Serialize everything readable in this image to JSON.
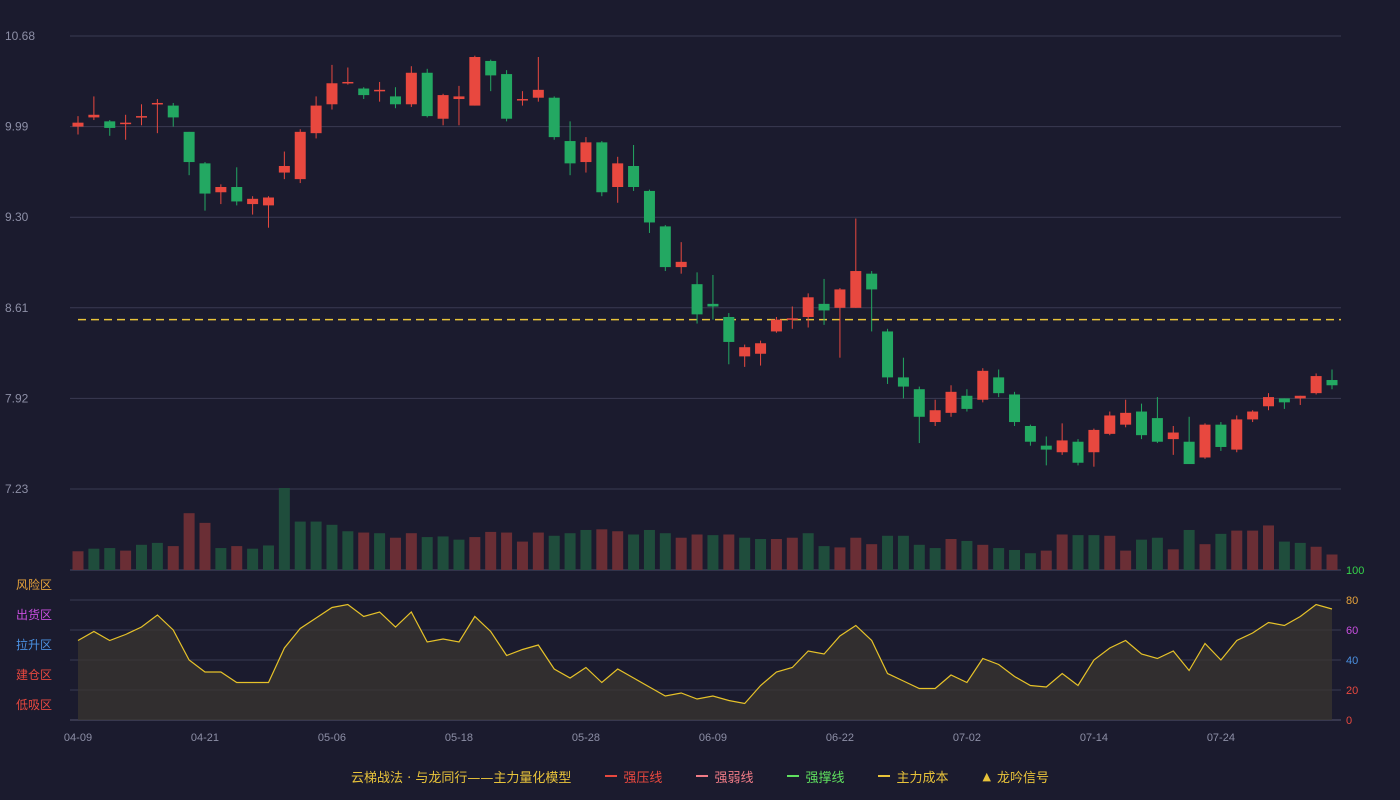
{
  "colors": {
    "background": "#1b1b2e",
    "up": "#e8483f",
    "down": "#23a862",
    "up_volume": "#6a2e35",
    "down_volume": "#1f4d3c",
    "main_cost_line": "#e8c33a",
    "indicator_line": "#e6c229",
    "grid": "#3a3b52",
    "tick_text": "#8d8fa6"
  },
  "chart_data": [
    {
      "type": "candlestick",
      "yticks": [
        "10.68",
        "9.99",
        "9.30",
        "8.61",
        "7.92",
        "7.23"
      ],
      "ylim": [
        7.23,
        10.68
      ],
      "xticks": [
        "04-09",
        "04-21",
        "05-06",
        "05-18",
        "05-28",
        "06-09",
        "06-22",
        "07-02",
        "07-14",
        "07-24"
      ],
      "xtick_index": [
        0,
        8,
        16,
        24,
        32,
        40,
        48,
        56,
        64,
        72
      ],
      "main_cost_level": 8.52,
      "candles": [
        [
          9.99,
          10.02,
          10.07,
          9.93
        ],
        [
          10.06,
          10.08,
          10.22,
          10.04
        ],
        [
          10.03,
          9.98,
          10.04,
          9.92
        ],
        [
          10.02,
          10.02,
          10.08,
          9.89
        ],
        [
          10.06,
          10.07,
          10.16,
          10.0
        ],
        [
          10.16,
          10.17,
          10.2,
          9.94
        ],
        [
          10.15,
          10.06,
          10.17,
          9.99
        ],
        [
          9.95,
          9.72,
          9.95,
          9.62
        ],
        [
          9.71,
          9.48,
          9.72,
          9.35
        ],
        [
          9.49,
          9.53,
          9.55,
          9.4
        ],
        [
          9.53,
          9.42,
          9.68,
          9.39
        ],
        [
          9.4,
          9.44,
          9.46,
          9.32
        ],
        [
          9.39,
          9.45,
          9.46,
          9.22
        ],
        [
          9.64,
          9.69,
          9.8,
          9.59
        ],
        [
          9.59,
          9.95,
          9.97,
          9.56
        ],
        [
          9.94,
          10.15,
          10.22,
          9.9
        ],
        [
          10.16,
          10.32,
          10.46,
          10.12
        ],
        [
          10.32,
          10.33,
          10.44,
          10.31
        ],
        [
          10.28,
          10.23,
          10.29,
          10.2
        ],
        [
          10.26,
          10.27,
          10.33,
          10.18
        ],
        [
          10.22,
          10.16,
          10.29,
          10.13
        ],
        [
          10.16,
          10.4,
          10.45,
          10.14
        ],
        [
          10.4,
          10.07,
          10.43,
          10.06
        ],
        [
          10.05,
          10.23,
          10.24,
          10.0
        ],
        [
          10.2,
          10.22,
          10.3,
          10.0
        ],
        [
          10.15,
          10.52,
          10.53,
          10.15
        ],
        [
          10.49,
          10.38,
          10.5,
          10.26
        ],
        [
          10.39,
          10.05,
          10.42,
          10.03
        ],
        [
          10.19,
          10.2,
          10.26,
          10.15
        ],
        [
          10.21,
          10.27,
          10.52,
          10.18
        ],
        [
          10.21,
          9.91,
          10.22,
          9.89
        ],
        [
          9.88,
          9.71,
          10.03,
          9.62
        ],
        [
          9.72,
          9.87,
          9.91,
          9.64
        ],
        [
          9.87,
          9.49,
          9.88,
          9.46
        ],
        [
          9.53,
          9.71,
          9.76,
          9.41
        ],
        [
          9.69,
          9.53,
          9.85,
          9.5
        ],
        [
          9.5,
          9.26,
          9.51,
          9.18
        ],
        [
          9.23,
          8.92,
          9.24,
          8.89
        ],
        [
          8.92,
          8.96,
          9.11,
          8.87
        ],
        [
          8.79,
          8.56,
          8.88,
          8.49
        ],
        [
          8.64,
          8.62,
          8.86,
          8.52
        ],
        [
          8.54,
          8.35,
          8.57,
          8.18
        ],
        [
          8.24,
          8.31,
          8.33,
          8.16
        ],
        [
          8.26,
          8.34,
          8.36,
          8.17
        ],
        [
          8.43,
          8.52,
          8.54,
          8.42
        ],
        [
          8.53,
          8.53,
          8.62,
          8.45
        ],
        [
          8.54,
          8.69,
          8.72,
          8.46
        ],
        [
          8.64,
          8.59,
          8.83,
          8.48
        ],
        [
          8.61,
          8.75,
          8.76,
          8.23
        ],
        [
          8.61,
          8.89,
          9.29,
          8.61
        ],
        [
          8.87,
          8.75,
          8.89,
          8.43
        ],
        [
          8.43,
          8.08,
          8.45,
          8.03
        ],
        [
          8.08,
          8.01,
          8.23,
          7.92
        ],
        [
          7.99,
          7.78,
          8.01,
          7.58
        ],
        [
          7.74,
          7.83,
          7.91,
          7.71
        ],
        [
          7.81,
          7.97,
          8.02,
          7.78
        ],
        [
          7.94,
          7.84,
          7.99,
          7.82
        ],
        [
          7.91,
          8.13,
          8.15,
          7.89
        ],
        [
          8.08,
          7.96,
          8.14,
          7.93
        ],
        [
          7.95,
          7.74,
          7.97,
          7.71
        ],
        [
          7.71,
          7.59,
          7.72,
          7.56
        ],
        [
          7.56,
          7.53,
          7.63,
          7.41
        ],
        [
          7.51,
          7.6,
          7.73,
          7.49
        ],
        [
          7.59,
          7.43,
          7.61,
          7.41
        ],
        [
          7.51,
          7.68,
          7.69,
          7.4
        ],
        [
          7.65,
          7.79,
          7.82,
          7.64
        ],
        [
          7.72,
          7.81,
          7.91,
          7.7
        ],
        [
          7.82,
          7.64,
          7.88,
          7.61
        ],
        [
          7.77,
          7.59,
          7.93,
          7.58
        ],
        [
          7.61,
          7.66,
          7.71,
          7.49
        ],
        [
          7.59,
          7.42,
          7.78,
          7.43
        ],
        [
          7.47,
          7.72,
          7.73,
          7.46
        ],
        [
          7.72,
          7.55,
          7.74,
          7.52
        ],
        [
          7.53,
          7.76,
          7.79,
          7.51
        ],
        [
          7.76,
          7.82,
          7.83,
          7.74
        ],
        [
          7.86,
          7.93,
          7.96,
          7.83
        ],
        [
          7.92,
          7.89,
          7.92,
          7.84
        ],
        [
          7.92,
          7.94,
          7.94,
          7.87
        ],
        [
          7.96,
          8.09,
          8.11,
          7.95
        ],
        [
          8.06,
          8.02,
          8.14,
          7.99
        ]
      ]
    },
    {
      "type": "bar",
      "name": "volume",
      "values": [
        29,
        33,
        34,
        30,
        39,
        42,
        37,
        88,
        73,
        34,
        37,
        33,
        38,
        127,
        75,
        75,
        70,
        60,
        58,
        57,
        50,
        57,
        51,
        52,
        47,
        51,
        59,
        58,
        44,
        58,
        53,
        57,
        62,
        63,
        60,
        55,
        62,
        57,
        50,
        55,
        54,
        55,
        50,
        48,
        48,
        50,
        57,
        37,
        35,
        50,
        40,
        53,
        53,
        39,
        34,
        48,
        45,
        39,
        34,
        31,
        26,
        30,
        55,
        54,
        54,
        53,
        30,
        47,
        50,
        32,
        62,
        40,
        56,
        61,
        61,
        69,
        44,
        42,
        36,
        24
      ],
      "up_flags": [
        1,
        0,
        0,
        1,
        0,
        0,
        1,
        1,
        1,
        0,
        1,
        0,
        0,
        0,
        0,
        0,
        0,
        0,
        1,
        0,
        1,
        1,
        0,
        0,
        0,
        1,
        1,
        1,
        1,
        1,
        0,
        0,
        0,
        1,
        1,
        0,
        0,
        0,
        1,
        1,
        0,
        1,
        0,
        0,
        1,
        1,
        0,
        0,
        1,
        1,
        1,
        0,
        0,
        0,
        0,
        1,
        0,
        1,
        0,
        0,
        0,
        1,
        1,
        0,
        0,
        1,
        1,
        0,
        0,
        1,
        0,
        1,
        0,
        1,
        1,
        1,
        0,
        0,
        1,
        1
      ]
    },
    {
      "type": "line",
      "ylim": [
        0,
        100
      ],
      "yticks": [
        "0",
        "20",
        "40",
        "60",
        "80",
        "100"
      ],
      "zone_labels": [
        "风险区",
        "出货区",
        "拉升区",
        "建仓区",
        "低吸区"
      ],
      "values": [
        53,
        59,
        53,
        57,
        62,
        70,
        60,
        40,
        32,
        32,
        25,
        25,
        25,
        48,
        61,
        68,
        75,
        77,
        69,
        72,
        62,
        72,
        52,
        54,
        52,
        69,
        59,
        43,
        47,
        50,
        34,
        28,
        35,
        25,
        34,
        28,
        22,
        16,
        18,
        14,
        16,
        13,
        11,
        23,
        32,
        35,
        46,
        44,
        56,
        63,
        53,
        31,
        26,
        21,
        21,
        30,
        25,
        41,
        37,
        29,
        23,
        22,
        31,
        23,
        40,
        48,
        53,
        44,
        41,
        46,
        33,
        51,
        40,
        53,
        58,
        65,
        63,
        69,
        77,
        74
      ]
    }
  ],
  "legend": {
    "title": "云梯战法 · 与龙同行——主力量化模型",
    "items": [
      {
        "label": "强压线",
        "color": "#e8483f",
        "style": "solid"
      },
      {
        "label": "强弱线",
        "color": "#f07b86",
        "style": "dashed"
      },
      {
        "label": "强撑线",
        "color": "#5fe05f",
        "style": "solid"
      },
      {
        "label": "主力成本",
        "color": "#e8c33a",
        "style": "dashed"
      },
      {
        "label": "龙吟信号",
        "color": "#e8c33a",
        "style": "triangle"
      }
    ]
  }
}
